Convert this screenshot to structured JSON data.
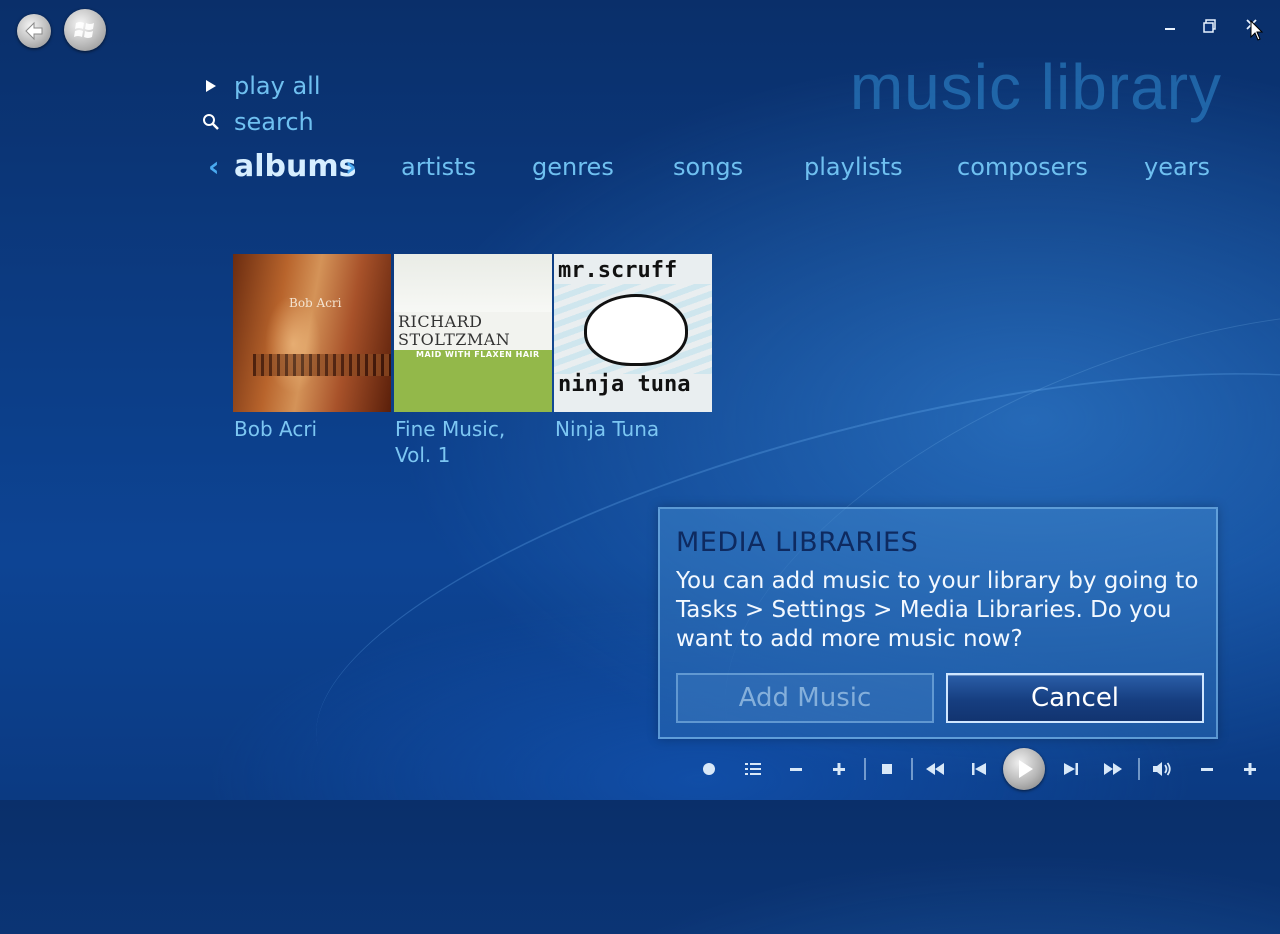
{
  "page": {
    "title": "music library"
  },
  "actions": {
    "play_all": "play all",
    "search": "search"
  },
  "nav": {
    "items": [
      "albums",
      "artists",
      "genres",
      "songs",
      "playlists",
      "composers",
      "years"
    ],
    "selected": "albums"
  },
  "albums": [
    {
      "name": "Bob Acri",
      "cover_text": "Bob Acri"
    },
    {
      "name": "Fine Music, Vol. 1",
      "name_line1": "Fine Music,",
      "name_line2": "Vol. 1",
      "cover_line1": "RICHARD",
      "cover_line2": "STOLTZMAN",
      "cover_sub": "MAID WITH FLAXEN HAIR"
    },
    {
      "name": "Ninja Tuna",
      "cover_line1": "mr.scruff",
      "cover_line2": "ninja tuna"
    }
  ],
  "dialog": {
    "heading": "MEDIA LIBRARIES",
    "message": "You can add music to your library by going to Tasks > Settings > Media Libraries. Do you want to add more music now?",
    "add_label": "Add Music",
    "cancel_label": "Cancel"
  },
  "icons": {
    "back": "back-arrow-icon",
    "start": "windows-logo-icon",
    "minimize": "minimize-icon",
    "restore": "restore-icon",
    "close": "close-icon"
  },
  "colors": {
    "accent": "#6fc0f0",
    "selected": "#d6eeff",
    "heading": "#0e2a60"
  }
}
